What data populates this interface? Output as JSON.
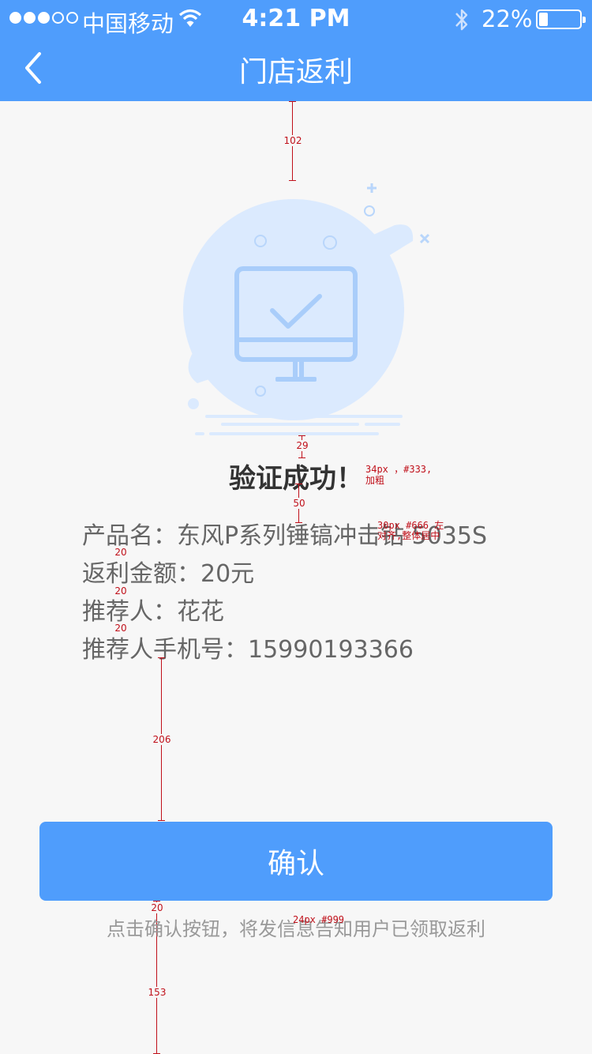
{
  "status": {
    "carrier": "中国移动",
    "time": "4:21 PM",
    "battery_pct": "22%",
    "battery_level": 0.22,
    "signal_bars": 3
  },
  "nav": {
    "title": "门店返利",
    "back_icon": "chevron-left-icon"
  },
  "result": {
    "title": "验证成功！"
  },
  "info": {
    "product": "产品名：东风P系列锤镐冲击钻 5035S",
    "amount": "返利金额：20元",
    "referrer": "推荐人：花花",
    "phone": "推荐人手机号：15990193366"
  },
  "actions": {
    "confirm_label": "确认",
    "hint": "点击确认按钮，将发信息告知用户已领取返利"
  },
  "spec": {
    "gap_top": "102",
    "gap_title": "29",
    "gap_info": "50",
    "line_gap": "20",
    "gap_button": "206",
    "gap_hint": "20",
    "gap_bottom": "153",
    "note_title": "34px ，#333,加粗",
    "note_info": "30px #666 左对齐,整体居中",
    "note_hint": "24px #999"
  },
  "colors": {
    "primary": "#4f9dfc",
    "title_text": "#333333",
    "body_text": "#666666",
    "hint_text": "#999999",
    "annotation": "#c0101a"
  }
}
